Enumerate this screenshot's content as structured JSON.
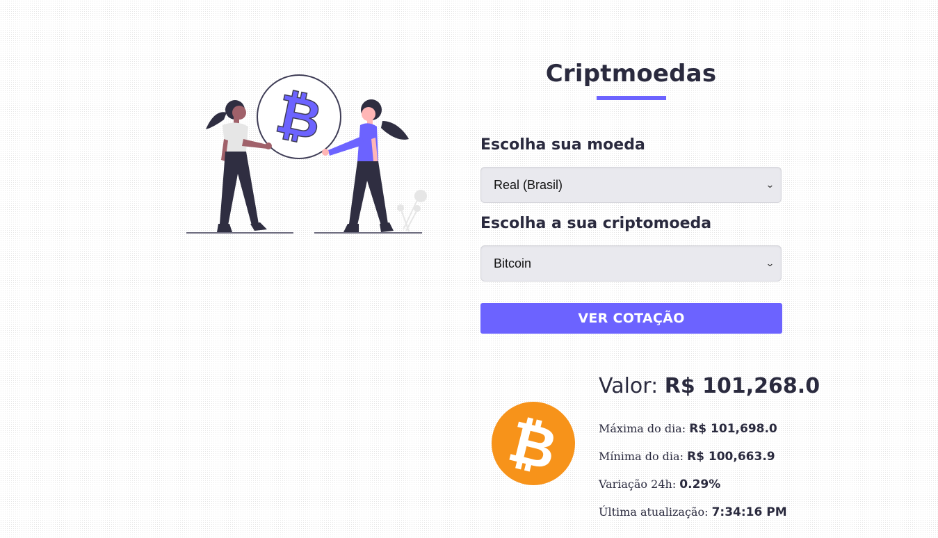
{
  "title": "Criptmoedas",
  "form": {
    "coin_label": "Escolha sua moeda",
    "coin_selected": "Real (Brasil)",
    "crypto_label": "Escolha a sua criptomoeda",
    "crypto_selected": "Bitcoin",
    "submit_label": "VER COTAÇÃO"
  },
  "result": {
    "value_label": "Valor:",
    "value": "R$ 101,268.0",
    "max_label": "Máxima do dia:",
    "max_value": "R$ 101,698.0",
    "min_label": "Mínima do dia:",
    "min_value": "R$ 100,663.9",
    "var_label": "Variação 24h:",
    "var_value": "0.29%",
    "update_label": "Última atualização:",
    "update_value": "7:34:16 PM"
  },
  "icons": {
    "illustration": "people-exchanging-bitcoin-illustration",
    "coin": "bitcoin-icon",
    "select_arrow": "chevron-down-icon"
  },
  "colors": {
    "accent": "#6c63ff",
    "bitcoin": "#f7931a",
    "text": "#2a2a3e"
  }
}
